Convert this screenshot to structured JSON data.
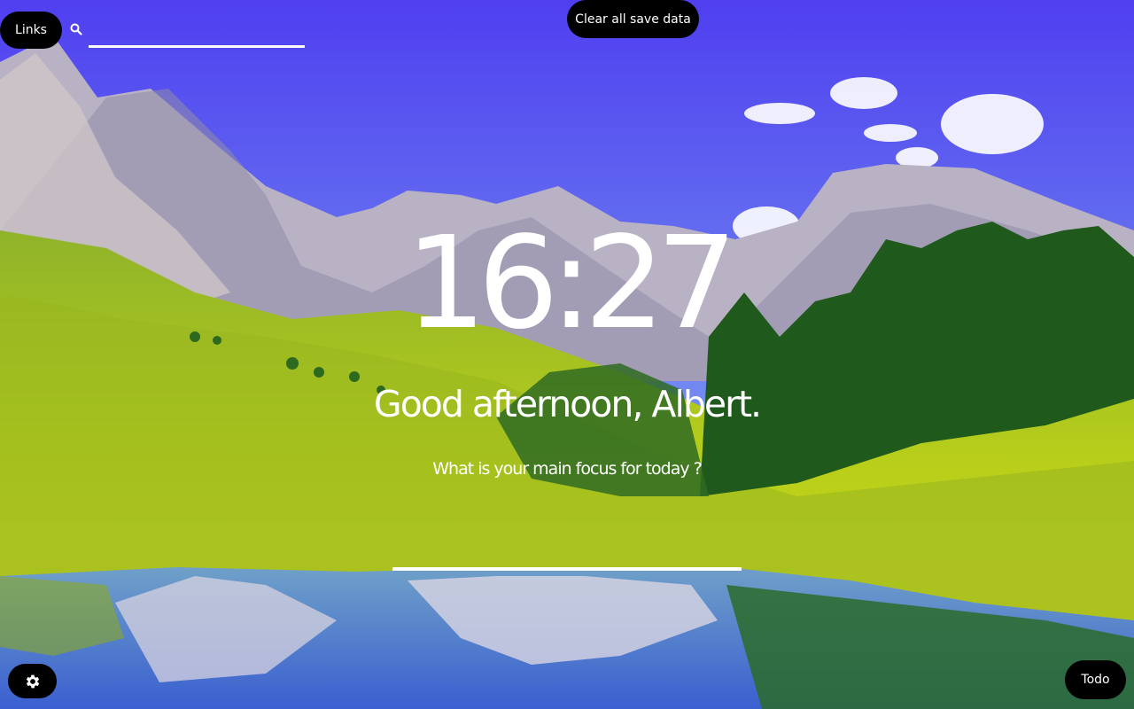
{
  "background": {
    "sky_color": "#5b52e0",
    "scene": "mountain-lake-landscape"
  },
  "header": {
    "links_label": "Links",
    "search_icon": "search-icon",
    "search_value": "",
    "clear_label": "Clear all save data"
  },
  "main": {
    "time": "16:27",
    "greeting": "Good afternoon, Albert.",
    "focus_question": "What is your main focus for today ?",
    "focus_value": ""
  },
  "footer": {
    "settings_icon": "gear-icon",
    "todo_label": "Todo"
  }
}
